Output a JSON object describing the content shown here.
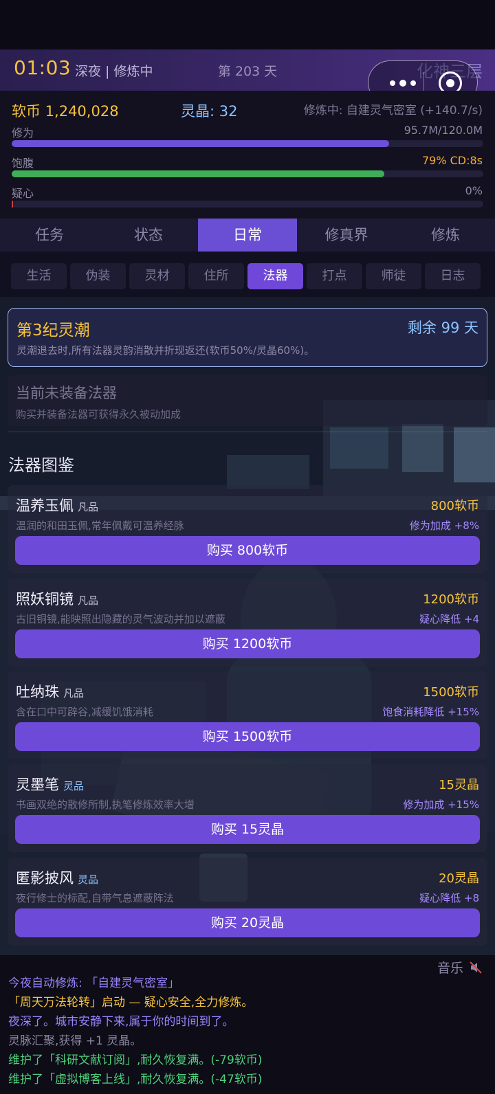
{
  "header": {
    "clock": "01:03",
    "phase": "深夜 | 修炼中",
    "day": "第 203 天",
    "realm": "化神三层"
  },
  "stats": {
    "coins": "软币 1,240,028",
    "crystal": "灵晶: 32",
    "cultivating": "修炼中: 自建灵气密室 (+140.7/s)",
    "bars": [
      {
        "label": "修为",
        "value": "95.7M/120.0M",
        "fraction": 0.8,
        "color": "#6d4fd8",
        "value_color": "#8c87a4"
      },
      {
        "label": "饱腹",
        "value": "79%  CD:8s",
        "fraction": 0.79,
        "color": "#3fae58",
        "value_color": "#f6a93c"
      },
      {
        "label": "疑心",
        "value": "0%",
        "fraction": 0.0,
        "color": "#d23b3b",
        "value_color": "#8c87a4"
      }
    ]
  },
  "main_tabs": [
    {
      "label": "任务",
      "active": false
    },
    {
      "label": "状态",
      "active": false
    },
    {
      "label": "日常",
      "active": true
    },
    {
      "label": "修真界",
      "active": false
    },
    {
      "label": "修炼",
      "active": false
    }
  ],
  "sub_tabs": [
    {
      "label": "生活",
      "active": false
    },
    {
      "label": "伪装",
      "active": false
    },
    {
      "label": "灵材",
      "active": false
    },
    {
      "label": "住所",
      "active": false
    },
    {
      "label": "法器",
      "active": true
    },
    {
      "label": "打点",
      "active": false
    },
    {
      "label": "师徒",
      "active": false
    },
    {
      "label": "日志",
      "active": false
    }
  ],
  "tide": {
    "title": "第3纪灵潮",
    "remaining": "剩余 99 天",
    "desc": "灵潮退去时,所有法器灵韵消散并折现返还(软币50%/灵晶60%)。"
  },
  "equip": {
    "title": "当前未装备法器",
    "desc": "购买并装备法器可获得永久被动加成"
  },
  "catalog_title": "法器图鉴",
  "items": [
    {
      "name": "温养玉佩",
      "grade": "凡品",
      "grade_type": "mortal",
      "price": "800软币",
      "desc": "温润的和田玉佩,常年佩戴可温养经脉",
      "effect": "修为加成 +8%",
      "button": "购买 800软币"
    },
    {
      "name": "照妖铜镜",
      "grade": "凡品",
      "grade_type": "mortal",
      "price": "1200软币",
      "desc": "古旧铜镜,能映照出隐藏的灵气波动并加以遮蔽",
      "effect": "疑心降低 +4",
      "button": "购买 1200软币"
    },
    {
      "name": "吐纳珠",
      "grade": "凡品",
      "grade_type": "mortal",
      "price": "1500软币",
      "desc": "含在口中可辟谷,减缓饥饿消耗",
      "effect": "饱食消耗降低 +15%",
      "button": "购买 1500软币"
    },
    {
      "name": "灵墨笔",
      "grade": "灵品",
      "grade_type": "spirit",
      "price": "15灵晶",
      "desc": "书画双绝的散修所制,执笔修炼效率大增",
      "effect": "修为加成 +15%",
      "button": "购买 15灵晶"
    },
    {
      "name": "匿影披风",
      "grade": "灵品",
      "grade_type": "spirit",
      "price": "20灵晶",
      "desc": "夜行修士的标配,自带气息遮蔽阵法",
      "effect": "疑心降低 +8",
      "button": "购买 20灵晶"
    }
  ],
  "music_label": "音乐",
  "log": [
    {
      "text": "今夜自动修炼: 「自建灵气密室」",
      "color": "#9b82ff"
    },
    {
      "text": "「周天万法轮转」启动 — 疑心安全,全力修炼。",
      "color": "#f6c33c"
    },
    {
      "text": "夜深了。城市安静下来,属于你的时间到了。",
      "color": "#9b82ff"
    },
    {
      "text": "灵脉汇聚,获得 +1 灵晶。",
      "color": "#8a86a0"
    },
    {
      "text": "维护了「科研文献订阅」,耐久恢复满。(-79软币)",
      "color": "#4fd07a"
    },
    {
      "text": "维护了「虚拟博客上线」,耐久恢复满。(-47软币)",
      "color": "#4fd07a"
    }
  ]
}
